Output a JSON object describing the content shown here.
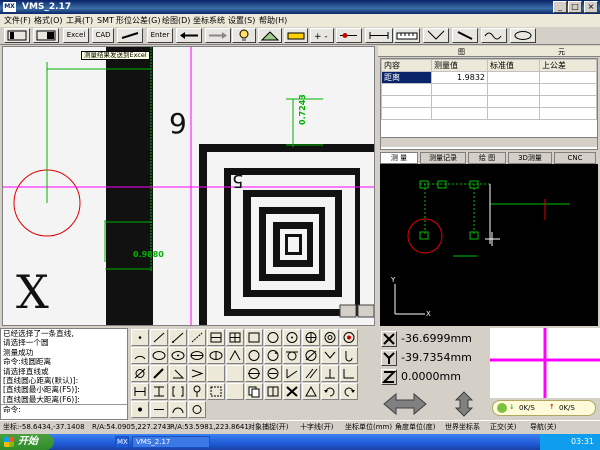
{
  "window": {
    "app_icon": "MX",
    "title": "VMS_2.17"
  },
  "menu": [
    "文件(F)",
    "格式(O)",
    "工具(T)",
    "SMT",
    "形位公差(G)",
    "绘图(D)",
    "坐标系统",
    "设置(S)",
    "帮助(H)"
  ],
  "toolbar": {
    "excel": "Excel",
    "cad": "CAD",
    "enter": "Enter"
  },
  "view": {
    "tooltip": "测量结果发送到Excel",
    "measure_top": "0.7243",
    "measure_left": "0.9880",
    "big_letter": "X",
    "num_9": "9",
    "num_5": "5"
  },
  "panel_header": {
    "left": "图",
    "right": "元"
  },
  "table": {
    "headers": [
      "内容",
      "测量值",
      "标准值",
      "上公差"
    ],
    "rows": [
      [
        "距离",
        "1.9832",
        "",
        ""
      ]
    ]
  },
  "tabs": [
    "测 量",
    "测量记录",
    "绘 图",
    "3D测量",
    "CNC"
  ],
  "command_log": [
    "已经选择了一条直线,",
    "请选择一个圆",
    "测量成功",
    "命令:线圆距离",
    "请选择直线或",
    "[直线圆心距离(默认)]:",
    "[直线圆最小距离(F5)]:",
    "[直线圆最大距离(F6)]:"
  ],
  "command_prompt": "命令:",
  "coords": {
    "x": "-36.6999mm",
    "y": "-39.7354mm",
    "z": "0.0000mm"
  },
  "tray_speed": {
    "down": "0K/S",
    "up": "0K/S"
  },
  "statusbar": [
    "坐标:-58.6434,-37.1408",
    "R/A:54.0905,227.2743",
    "R/A:53.5981,223.8641",
    "对象捕捉(开)",
    "十字线(开)",
    "坐标单位(mm)",
    "角度单位(度)",
    "世界坐标系",
    "正交(关)",
    "导航(关)"
  ],
  "taskbar": {
    "start": "开始",
    "task_icon": "MX",
    "task": "VMS_2.17",
    "time": "03:31"
  },
  "colors": {
    "title": "#0a246a",
    "accent_magenta": "#ff00ff",
    "measure_green": "#00c000",
    "circle_red": "#e00000"
  }
}
